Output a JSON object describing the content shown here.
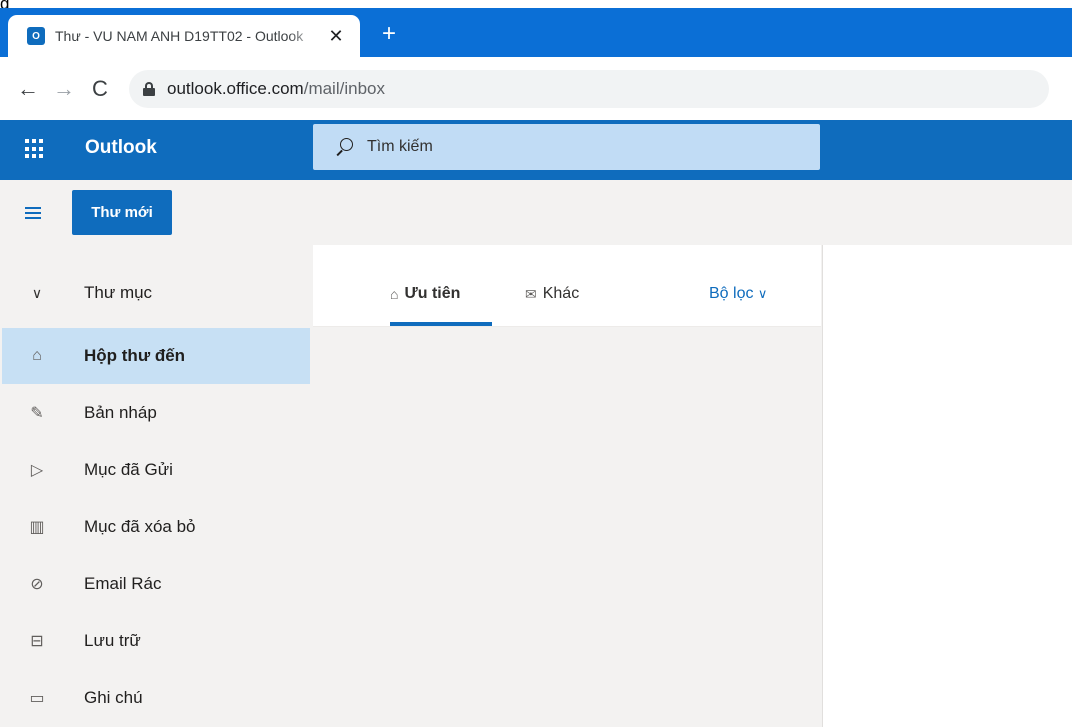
{
  "top_fragment": "g",
  "browser": {
    "tab_title": "Thư - VU NAM ANH D19TT02 - Outlook",
    "tab_close": "✕",
    "new_tab": "+",
    "back": "←",
    "forward": "→",
    "reload": "C",
    "url_host": "outlook.office.com",
    "url_path": "/mail/inbox"
  },
  "header": {
    "brand": "Outlook",
    "search_placeholder": "Tìm kiếm"
  },
  "command_bar": {
    "new_mail_label": "Thư mới"
  },
  "sidebar": {
    "folders_header": "Thư mục",
    "items": [
      {
        "label": "Hộp thư đến",
        "icon": "inbox-icon",
        "selected": true
      },
      {
        "label": "Bản nháp",
        "icon": "pencil-icon"
      },
      {
        "label": "Mục đã Gửi",
        "icon": "send-icon"
      },
      {
        "label": "Mục đã xóa bỏ",
        "icon": "trash-icon"
      },
      {
        "label": "Email Rác",
        "icon": "block-icon"
      },
      {
        "label": "Lưu trữ",
        "icon": "archive-icon"
      },
      {
        "label": "Ghi chú",
        "icon": "note-icon"
      }
    ]
  },
  "mail_list": {
    "tab_focused": "Ưu tiên",
    "tab_other": "Khác",
    "filter_label": "Bộ lọc",
    "filter_chevron": "∨"
  },
  "colors": {
    "brand_blue": "#0f6cbd",
    "browser_tabbar": "#0b6fd6",
    "selected_item": "#c7e0f4",
    "search_box": "#c1dcf5"
  }
}
